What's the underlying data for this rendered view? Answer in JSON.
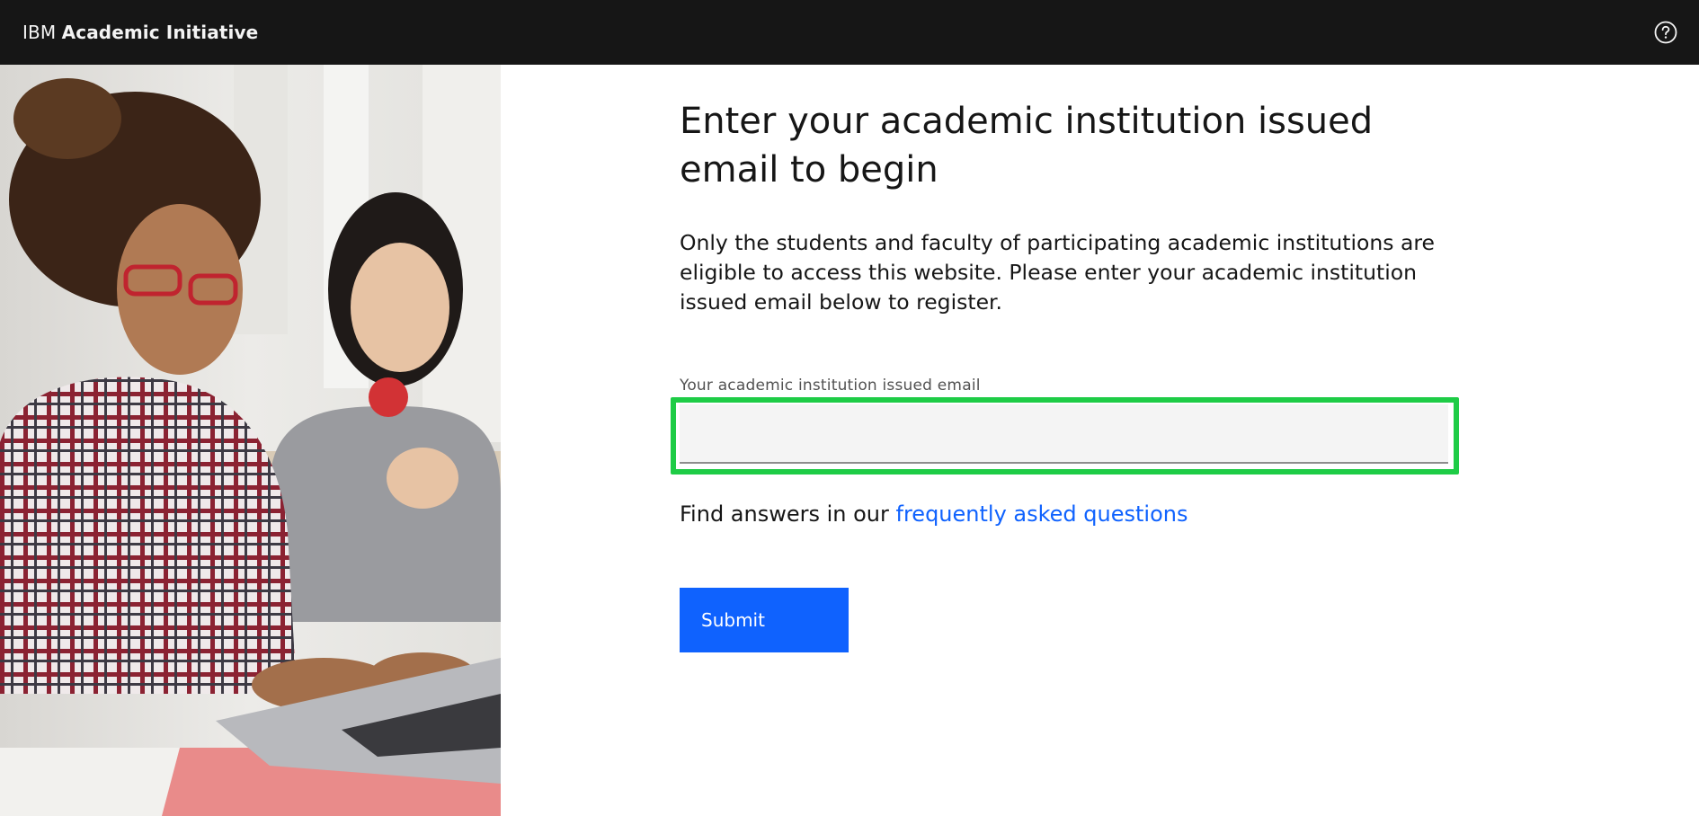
{
  "header": {
    "brand_prefix": "IBM",
    "brand_product": "Academic Initiative",
    "help_icon": "help-circle-icon",
    "background": "#161616"
  },
  "hero": {
    "image": "students-at-laptop-photo"
  },
  "main": {
    "heading": "Enter your academic institution issued email to begin",
    "description": "Only the students and faculty of participating academic institutions are eligible to access this website. Please enter your academic institution issued email below to register.",
    "email_label": "Your academic institution issued email",
    "email_value": "",
    "email_placeholder": "",
    "faq_prefix": "Find answers in our ",
    "faq_link": "frequently asked questions",
    "submit_label": "Submit"
  },
  "colors": {
    "accent": "#0f62fe",
    "highlight": "#1ecc46",
    "input_background": "#f4f4f4"
  }
}
